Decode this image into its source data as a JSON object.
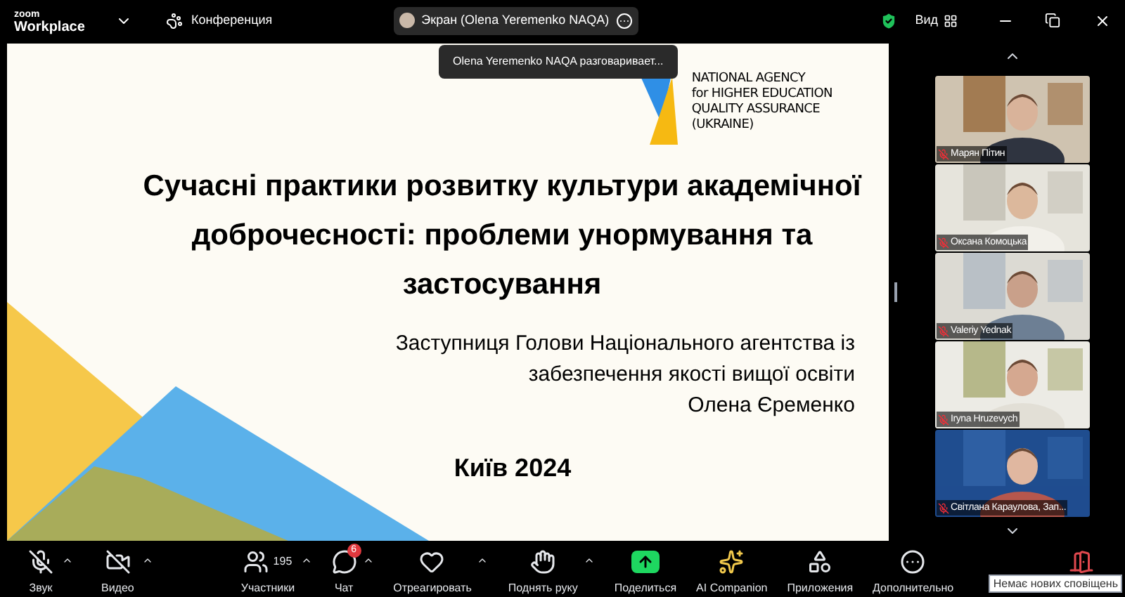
{
  "top_bar": {
    "brand_top": "zoom",
    "brand_bottom": "Workplace",
    "meeting": "Конференция",
    "share_chip": "Экран (Olena Yeremenko NAQA)",
    "view": "Вид",
    "speaking_tooltip": "Olena Yeremenko NAQA разговаривает..."
  },
  "slide": {
    "logo_lines": [
      "NATIONAL AGENCY",
      "for HIGHER EDUCATION",
      "QUALITY ASSURANCE",
      "(UKRAINE)"
    ],
    "title": "Сучасні практики розвитку культури академічної доброчесності: проблеми унормування та застосування",
    "subtitle_lines": [
      "Заступниця Голови Національного агентства із",
      "забезпечення якості вищої освіти",
      "Олена Єременко"
    ],
    "footer": "Київ 2024"
  },
  "participants": [
    {
      "name": "Марян Пітин",
      "muted": true
    },
    {
      "name": "Оксана Комоцька",
      "muted": true
    },
    {
      "name": "Valeriy Yednak",
      "muted": true
    },
    {
      "name": "Iryna Hruzevych",
      "muted": true
    },
    {
      "name": "Світлана Караулова, Зап...",
      "muted": true
    }
  ],
  "toolbar": {
    "audio": {
      "label": "Звук",
      "muted": true
    },
    "video": {
      "label": "Видео",
      "muted": true
    },
    "items": [
      {
        "kind": "participants",
        "label": "Участники",
        "count": "195",
        "caret": true
      },
      {
        "kind": "chat",
        "label": "Чат",
        "badge": "6",
        "caret": true
      },
      {
        "kind": "react",
        "label": "Отреагировать",
        "caret": true
      },
      {
        "kind": "hand",
        "label": "Поднять руку",
        "caret": true
      },
      {
        "kind": "share",
        "label": "Поделиться",
        "caret": false
      },
      {
        "kind": "ai",
        "label": "AI Companion",
        "caret": false
      },
      {
        "kind": "apps",
        "label": "Приложения",
        "caret": false
      },
      {
        "kind": "more",
        "label": "Дополнительно",
        "caret": false
      }
    ],
    "notification_tooltip": "Немає нових сповіщень"
  }
}
